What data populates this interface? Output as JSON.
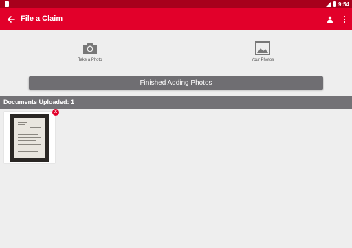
{
  "status_bar": {
    "time": "9:54"
  },
  "app_bar": {
    "title": "File a Claim",
    "back_icon": "arrow-left-icon",
    "profile_icon": "person-icon",
    "overflow_icon": "more-vert-icon",
    "background_color": "#e2002a"
  },
  "actions": {
    "take_photo": {
      "label": "Take a Photo",
      "icon": "camera-icon"
    },
    "your_photos": {
      "label": "Your Photos",
      "icon": "image-icon"
    },
    "finished_label": "Finished Adding Photos"
  },
  "documents": {
    "header": "Documents Uploaded: 1",
    "remove_label": "X"
  }
}
